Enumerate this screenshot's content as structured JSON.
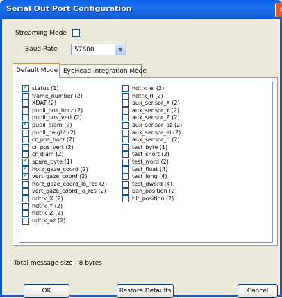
{
  "window": {
    "title": "Serial Out Port Configuration"
  },
  "streaming": {
    "label": "Streaming Mode",
    "checked": false
  },
  "baud": {
    "label": "Baud Rate",
    "value": "57600"
  },
  "tabs": [
    {
      "label": "Default Mode",
      "active": true
    },
    {
      "label": "EyeHead Integration Mode",
      "active": false
    }
  ],
  "items_col1": [
    {
      "label": "status (1)",
      "checked": true
    },
    {
      "label": "frame_number (2)",
      "checked": false
    },
    {
      "label": "XDAT (2)",
      "checked": false
    },
    {
      "label": "pupil_pos_horz (2)",
      "checked": false
    },
    {
      "label": "pupil_pos_vert (2)",
      "checked": false
    },
    {
      "label": "pupil_diam (2)",
      "checked": true
    },
    {
      "label": "pupil_height (2)",
      "checked": false
    },
    {
      "label": "cr_pos_horz (2)",
      "checked": false
    },
    {
      "label": "cr_pos_vert (2)",
      "checked": false
    },
    {
      "label": "cr_diam (2)",
      "checked": false
    },
    {
      "label": "spare_byte (1)",
      "checked": true
    },
    {
      "label": "horz_gaze_coord (2)",
      "checked": true
    },
    {
      "label": "vert_gaze_coord (2)",
      "checked": true
    },
    {
      "label": "horz_gaze_coord_lo_res (2)",
      "checked": false
    },
    {
      "label": "vert_gaze_coord_lo_res (2)",
      "checked": false
    },
    {
      "label": "hdtrk_X (2)",
      "checked": false
    },
    {
      "label": "hdtrk_Y (2)",
      "checked": false
    },
    {
      "label": "hdtrk_Z (2)",
      "checked": false
    },
    {
      "label": "hdtrk_az (2)",
      "checked": false
    }
  ],
  "items_col2": [
    {
      "label": "hdtrk_el (2)",
      "checked": false
    },
    {
      "label": "hdtrk_rl (2)",
      "checked": false
    },
    {
      "label": "aux_sensor_X (2)",
      "checked": false
    },
    {
      "label": "aux_sensor_Y (2)",
      "checked": false
    },
    {
      "label": "aux_sensor_Z (2)",
      "checked": false
    },
    {
      "label": "aux_sensor_az (2)",
      "checked": false
    },
    {
      "label": "aux_sensor_el (2)",
      "checked": false
    },
    {
      "label": "aux_sensor_rl (2)",
      "checked": false
    },
    {
      "label": "test_byte (1)",
      "checked": false
    },
    {
      "label": "test_short (2)",
      "checked": false
    },
    {
      "label": "test_word (2)",
      "checked": false
    },
    {
      "label": "test_float (4)",
      "checked": false
    },
    {
      "label": "test_long (4)",
      "checked": false
    },
    {
      "label": "test_dword (4)",
      "checked": false
    },
    {
      "label": "pan_position (2)",
      "checked": false
    },
    {
      "label": "tilt_position (2)",
      "checked": false
    }
  ],
  "status": {
    "text": "Total message size - 8 bytes"
  },
  "buttons": {
    "ok": "OK",
    "restore": "Restore Defaults",
    "cancel": "Cancel"
  },
  "colors": {
    "titlebar": "#0A5FE6",
    "face": "#ECE9D8",
    "check": "#21A121"
  }
}
